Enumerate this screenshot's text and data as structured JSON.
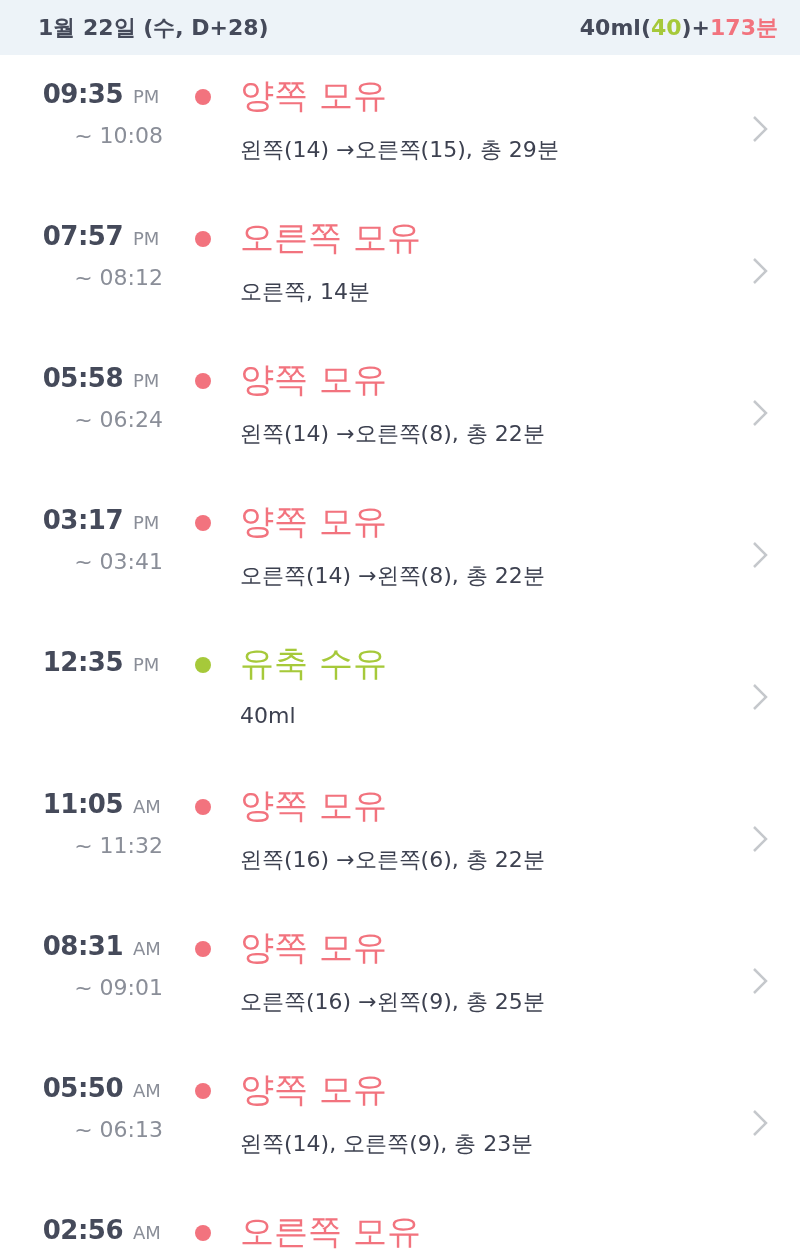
{
  "header": {
    "date": "1월 22일 (수, D+28)",
    "summary": [
      {
        "text": "40ml"
      },
      {
        "text": "("
      },
      {
        "text": "40",
        "color": "#a6c93a"
      },
      {
        "text": ")+"
      },
      {
        "text": "173분",
        "color": "#f2737e"
      }
    ]
  },
  "entries": [
    {
      "time": "09:35",
      "meridiem": "PM",
      "end": "~ 10:08",
      "title": "양쪽 모유",
      "detail": "왼쪽(14) →오른쪽(15), 총 29분",
      "color": "#f2737e"
    },
    {
      "time": "07:57",
      "meridiem": "PM",
      "end": "~ 08:12",
      "title": "오른쪽 모유",
      "detail": "오른쪽, 14분",
      "color": "#f2737e"
    },
    {
      "time": "05:58",
      "meridiem": "PM",
      "end": "~ 06:24",
      "title": "양쪽 모유",
      "detail": "왼쪽(14) →오른쪽(8), 총 22분",
      "color": "#f2737e"
    },
    {
      "time": "03:17",
      "meridiem": "PM",
      "end": "~ 03:41",
      "title": "양쪽 모유",
      "detail": "오른쪽(14) →왼쪽(8), 총 22분",
      "color": "#f2737e"
    },
    {
      "time": "12:35",
      "meridiem": "PM",
      "title": "유축 수유",
      "detail": "40ml",
      "color": "#a6c93a"
    },
    {
      "time": "11:05",
      "meridiem": "AM",
      "end": "~ 11:32",
      "title": "양쪽 모유",
      "detail": "왼쪽(16) →오른쪽(6), 총 22분",
      "color": "#f2737e"
    },
    {
      "time": "08:31",
      "meridiem": "AM",
      "end": "~ 09:01",
      "title": "양쪽 모유",
      "detail": "오른쪽(16) →왼쪽(9), 총 25분",
      "color": "#f2737e"
    },
    {
      "time": "05:50",
      "meridiem": "AM",
      "end": "~ 06:13",
      "title": "양쪽 모유",
      "detail": "왼쪽(14), 오른쪽(9), 총 23분",
      "color": "#f2737e"
    },
    {
      "time": "02:56",
      "meridiem": "AM",
      "title": "오른쪽 모유",
      "color": "#f2737e"
    }
  ]
}
